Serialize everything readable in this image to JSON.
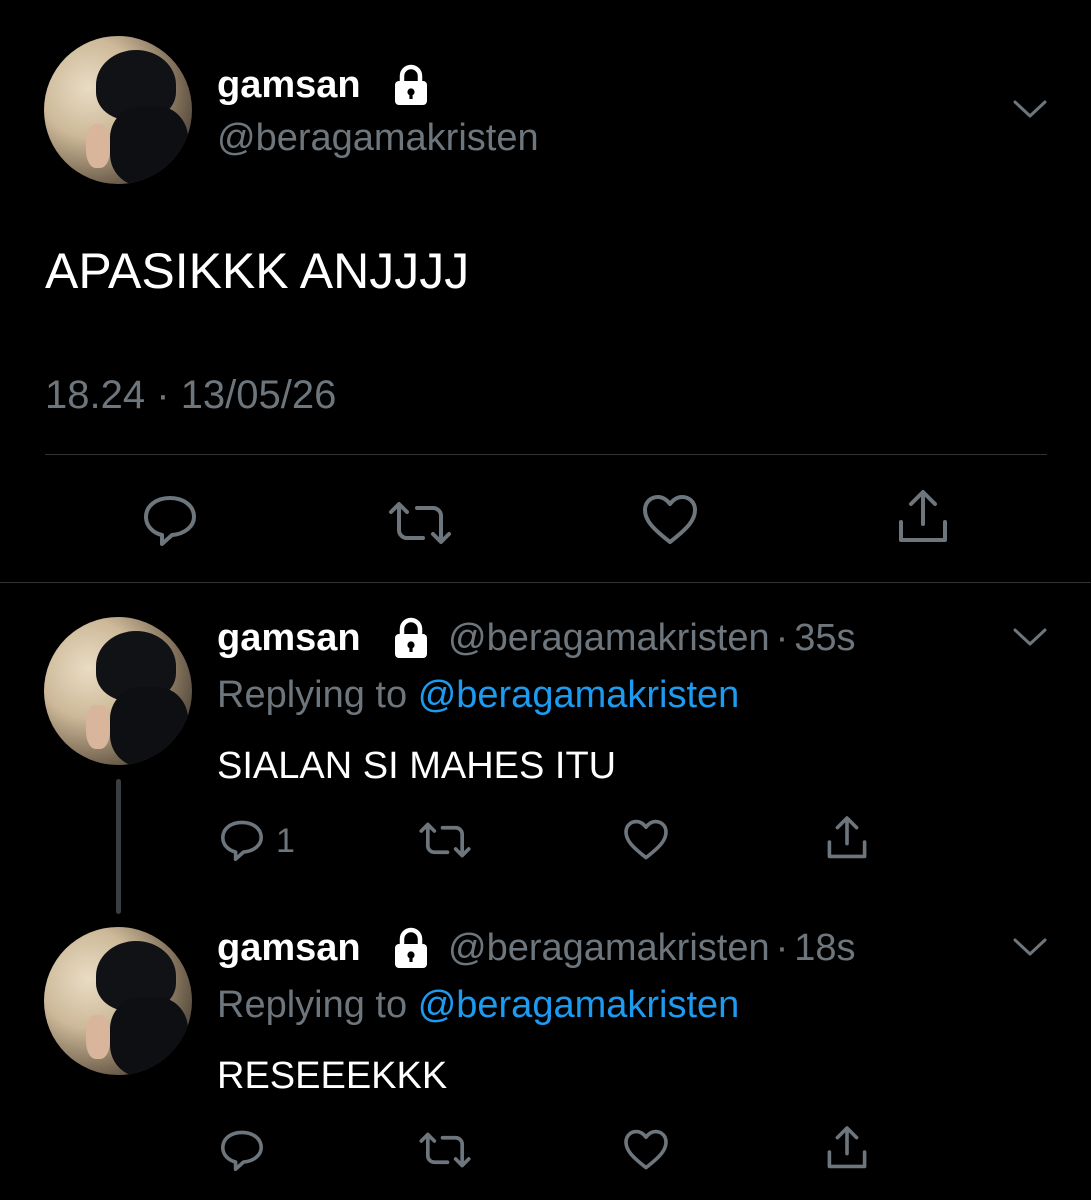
{
  "main_tweet": {
    "display_name": "gamsan",
    "handle": "@beragamakristen",
    "text": "APASIKKK ANJJJJ",
    "time": "18.24",
    "separator": "·",
    "date": "13/05/26"
  },
  "replies": [
    {
      "display_name": "gamsan",
      "handle": "@beragamakristen",
      "dot": "·",
      "age": "35s",
      "replying_label": "Replying to",
      "replying_handle": "@beragamakristen",
      "text": "SIALAN SI MAHES ITU",
      "reply_count": "1"
    },
    {
      "display_name": "gamsan",
      "handle": "@beragamakristen",
      "dot": "·",
      "age": "18s",
      "replying_label": "Replying to",
      "replying_handle": "@beragamakristen",
      "text": "RESEEEKKK",
      "reply_count": ""
    }
  ],
  "colors": {
    "background": "#000000",
    "muted": "#6e767d",
    "link": "#1d9bf0",
    "divider": "#2f3336"
  },
  "icons": [
    "lock-icon",
    "chevron-down-icon",
    "reply-icon",
    "retweet-icon",
    "like-icon",
    "share-icon"
  ]
}
